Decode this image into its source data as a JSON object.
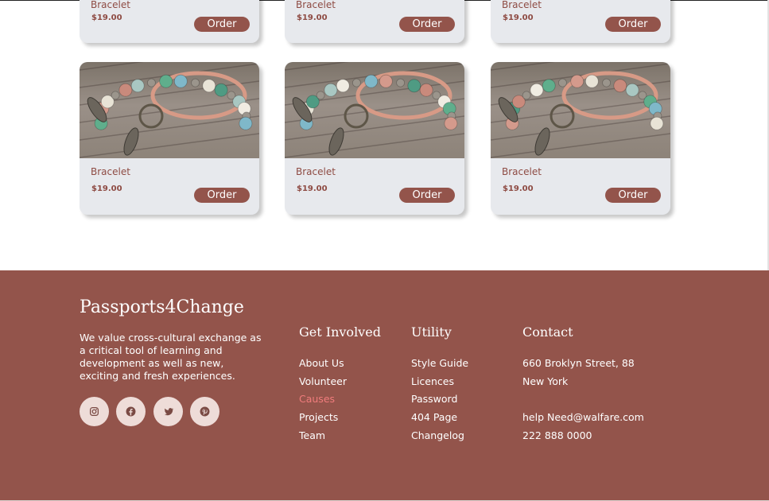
{
  "products": [
    {
      "title": "Bracelet",
      "price": "$19.00",
      "order_label": "Order"
    },
    {
      "title": "Bracelet",
      "price": "$19.00",
      "order_label": "Order"
    },
    {
      "title": "Bracelet",
      "price": "$19.00",
      "order_label": "Order"
    },
    {
      "title": "Bracelet",
      "price": "$19.00",
      "order_label": "Order"
    },
    {
      "title": "Bracelet",
      "price": "$19.00",
      "order_label": "Order"
    },
    {
      "title": "Bracelet",
      "price": "$19.00",
      "order_label": "Order"
    }
  ],
  "footer": {
    "brand": "Passports4Change",
    "tagline": "We value cross-cultural exchange as a critical tool of learning and development as well as new, exciting and fresh experiences.",
    "social_icons": [
      "instagram-icon",
      "facebook-icon",
      "twitter-icon",
      "pinterest-icon"
    ],
    "get_involved": {
      "heading": "Get Involved",
      "links": [
        "About Us",
        "Volunteer",
        "Causes",
        "Projects",
        "Team"
      ],
      "active": "Causes"
    },
    "utility": {
      "heading": "Utility",
      "links": [
        "Style Guide",
        "Licences",
        "Password",
        "404 Page",
        "Changelog"
      ]
    },
    "contact": {
      "heading": "Contact",
      "address_line1": "660 Broklyn Street, 88",
      "address_line2": "New York",
      "email": "help Need@walfare.com",
      "phone": "222 888 0000"
    }
  },
  "colors": {
    "brand": "#93544b",
    "card_bg": "#e7e9ed",
    "active_link": "#f07c7c",
    "social_bg": "#eedcd8"
  }
}
